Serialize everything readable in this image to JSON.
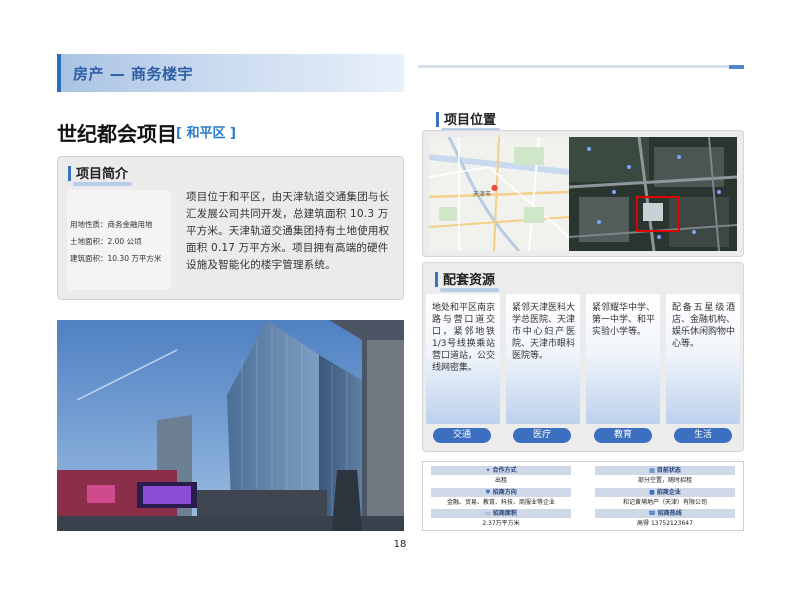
{
  "header": {
    "category": "房产 — 商务楼宇"
  },
  "project": {
    "name": "世纪都会项目",
    "district": "[ 和平区 ]"
  },
  "intro": {
    "heading": "项目简介",
    "facts": [
      "用地性质：商务金融用地",
      "土地面积：2.00 公顷",
      "建筑面积：10.30 万平方米"
    ],
    "description": "项目位于和平区，由天津轨道交通集团与长汇发展公司共同开发，总建筑面积 10.3 万平方米。天津轨道交通集团持有土地使用权面积 0.17 万平方米。项目拥有高端的硬件设施及智能化的楼宇管理系统。"
  },
  "location": {
    "heading": "项目位置",
    "map_label": "天津市"
  },
  "resources": {
    "heading": "配套资源",
    "items": [
      {
        "text": "地处和平区南京路与营口道交口，紧邻地铁1/3号线换乘站营口道站，公交线网密集。",
        "label": "交通"
      },
      {
        "text": "紧邻天津医科大学总医院、天津市中心妇产医院、天津市眼科医院等。",
        "label": "医疗"
      },
      {
        "text": "紧邻耀华中学、第一中学、和平实验小学等。",
        "label": "教育"
      },
      {
        "text": "配备五星级酒店、金融机构、娱乐休闲购物中心等。",
        "label": "生活"
      }
    ]
  },
  "info": {
    "coop_label": "合作方式",
    "coop_value": "出租",
    "status_label": "目前状态",
    "status_value": "部分空置，随时招租",
    "direction_label": "招商方向",
    "direction_value": "金融、贸易、教育、科技、商服业等企业",
    "company_label": "招商企业",
    "company_value": "和记黄埔地产（天津）有限公司",
    "area_label": "招商面积",
    "area_value": "2.37万平方米",
    "phone_label": "招商热线",
    "phone_value": "高得 13752123647"
  },
  "page": {
    "number": "18"
  },
  "colors": {
    "accent": "#2e6bb8",
    "pill": "#3d6fc0",
    "highlight": "#e00000"
  },
  "icons": {
    "coop": "handshake-icon",
    "status": "calendar-icon",
    "direction": "heart-icon",
    "company": "briefcase-icon",
    "area": "monitor-icon",
    "phone": "phone-icon"
  }
}
